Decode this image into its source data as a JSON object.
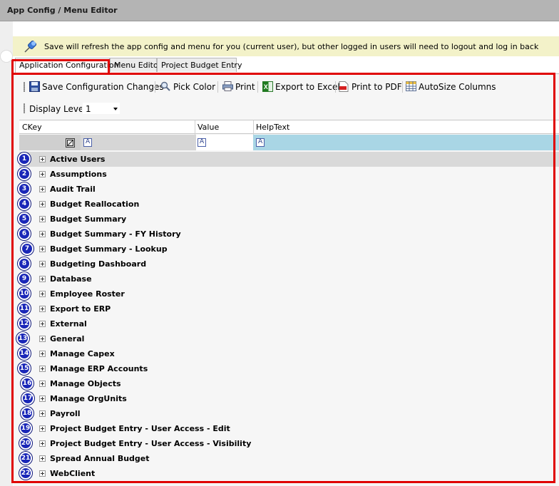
{
  "window": {
    "title": "App Config / Menu Editor"
  },
  "notice": {
    "text": "Save will refresh the app config and menu for you (current user), but other logged in users will need to logout and log in back",
    "icon": "pushpin-icon"
  },
  "tabs": [
    {
      "label": "Application Configuration",
      "active": true
    },
    {
      "label": "Menu Editor",
      "active": false
    },
    {
      "label": "Project Budget Entry",
      "active": false
    }
  ],
  "toolbar": {
    "save_label": "Save Configuration Changes",
    "pick_color_label": "Pick Color",
    "print_label": "Print",
    "export_excel_label": "Export to Excel",
    "print_pdf_label": "Print to PDF",
    "autosize_label": "AutoSize Columns"
  },
  "display_level": {
    "label": "Display Level",
    "value": "1"
  },
  "grid": {
    "columns": [
      "CKey",
      "Value",
      "HelpText"
    ],
    "rows": [
      {
        "num": "1",
        "label": "Active Users"
      },
      {
        "num": "2",
        "label": "Assumptions"
      },
      {
        "num": "3",
        "label": "Audit Trail"
      },
      {
        "num": "4",
        "label": "Budget Reallocation"
      },
      {
        "num": "5",
        "label": "Budget Summary"
      },
      {
        "num": "6",
        "label": "Budget Summary - FY History"
      },
      {
        "num": "7",
        "label": "Budget Summary - Lookup"
      },
      {
        "num": "8",
        "label": "Budgeting Dashboard"
      },
      {
        "num": "9",
        "label": "Database"
      },
      {
        "num": "10",
        "label": "Employee Roster"
      },
      {
        "num": "11",
        "label": "Export to ERP"
      },
      {
        "num": "12",
        "label": "External"
      },
      {
        "num": "13",
        "label": "General"
      },
      {
        "num": "14",
        "label": "Manage Capex"
      },
      {
        "num": "15",
        "label": "Manage ERP Accounts"
      },
      {
        "num": "16",
        "label": "Manage Objects"
      },
      {
        "num": "17",
        "label": "Manage OrgUnits"
      },
      {
        "num": "18",
        "label": "Payroll"
      },
      {
        "num": "19",
        "label": "Project Budget Entry - User Access - Edit"
      },
      {
        "num": "20",
        "label": "Project Budget Entry - User Access - Visibility"
      },
      {
        "num": "21",
        "label": "Spread Annual Budget"
      },
      {
        "num": "22",
        "label": "WebClient"
      }
    ]
  },
  "colors": {
    "highlight_border": "#e00000",
    "badge": "#1a27b8",
    "notice_bg": "#f3f2c9",
    "helptext_filter": "#a9d6e5"
  }
}
